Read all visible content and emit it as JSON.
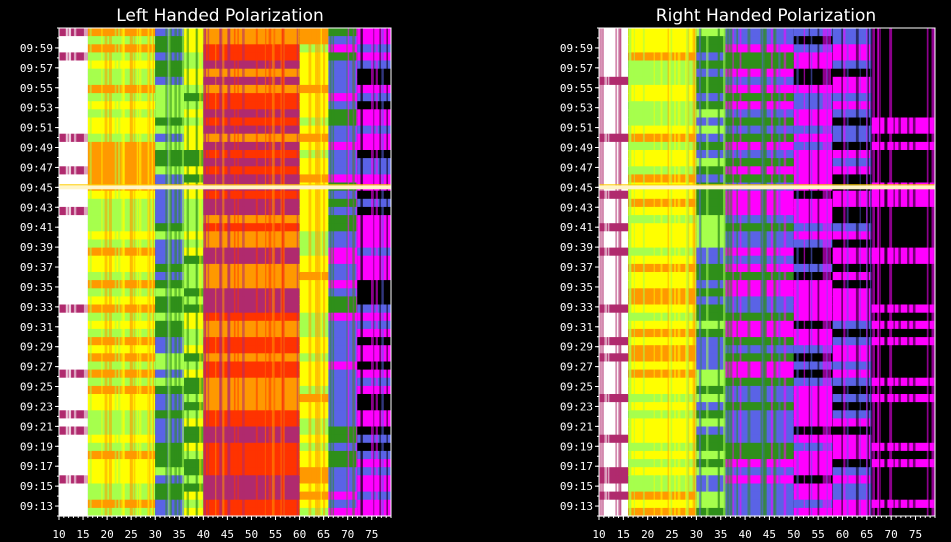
{
  "chart_data": [
    {
      "type": "heatmap",
      "title": "Left Handed Polarization",
      "x_ticks": [
        "10",
        "15",
        "20",
        "25",
        "30",
        "35",
        "40",
        "45",
        "50",
        "55",
        "60",
        "65",
        "70",
        "75"
      ],
      "xlim": [
        10,
        79
      ],
      "y_ticks": [
        "09:13",
        "09:15",
        "09:17",
        "09:19",
        "09:21",
        "09:23",
        "09:25",
        "09:27",
        "09:29",
        "09:31",
        "09:33",
        "09:35",
        "09:37",
        "09:39",
        "09:41",
        "09:43",
        "09:45",
        "09:47",
        "09:49",
        "09:51",
        "09:53",
        "09:55",
        "09:57",
        "09:59"
      ],
      "ylim": [
        "09:12",
        "10:01"
      ],
      "colorscale": [
        "#000000",
        "#ff00ff",
        "#5a63e6",
        "#2f8f1a",
        "#a6ff4d",
        "#ffff00",
        "#ff9900",
        "#ff3300",
        "#b02a6e",
        "#ffffff"
      ],
      "intensity_bands": [
        {
          "x": [
            10,
            16
          ],
          "level": 9
        },
        {
          "x": [
            16,
            30
          ],
          "level": 5
        },
        {
          "x": [
            30,
            36
          ],
          "level": 3
        },
        {
          "x": [
            36,
            40
          ],
          "level": 4
        },
        {
          "x": [
            40,
            60
          ],
          "level": 7
        },
        {
          "x": [
            60,
            66
          ],
          "level": 5
        },
        {
          "x": [
            66,
            72
          ],
          "level": 2
        },
        {
          "x": [
            72,
            79
          ],
          "level": 1
        }
      ],
      "burst_time": "09:45"
    },
    {
      "type": "heatmap",
      "title": "Right Handed Polarization",
      "x_ticks": [
        "10",
        "15",
        "20",
        "25",
        "30",
        "35",
        "40",
        "45",
        "50",
        "55",
        "60",
        "65",
        "70",
        "75"
      ],
      "xlim": [
        10,
        79
      ],
      "y_ticks": [
        "09:13",
        "09:15",
        "09:17",
        "09:19",
        "09:21",
        "09:23",
        "09:25",
        "09:27",
        "09:29",
        "09:31",
        "09:33",
        "09:35",
        "09:37",
        "09:39",
        "09:41",
        "09:43",
        "09:45",
        "09:47",
        "09:49",
        "09:51",
        "09:53",
        "09:55",
        "09:57",
        "09:59"
      ],
      "ylim": [
        "09:12",
        "10:01"
      ],
      "colorscale": [
        "#000000",
        "#ff00ff",
        "#5a63e6",
        "#2f8f1a",
        "#a6ff4d",
        "#ffff00",
        "#ff9900",
        "#ff3300",
        "#b02a6e",
        "#ffffff"
      ],
      "intensity_bands": [
        {
          "x": [
            10,
            16
          ],
          "level": 9
        },
        {
          "x": [
            16,
            30
          ],
          "level": 5
        },
        {
          "x": [
            30,
            36
          ],
          "level": 3
        },
        {
          "x": [
            36,
            50
          ],
          "level": 2
        },
        {
          "x": [
            50,
            58
          ],
          "level": 1
        },
        {
          "x": [
            58,
            66
          ],
          "level": 1
        },
        {
          "x": [
            66,
            79
          ],
          "level": 0
        }
      ],
      "burst_time": "09:45"
    }
  ]
}
